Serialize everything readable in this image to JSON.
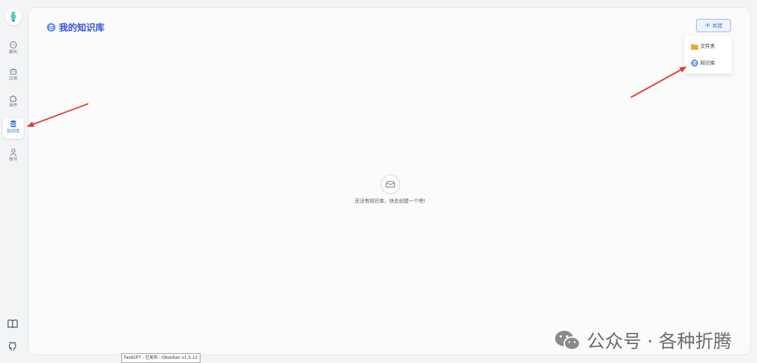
{
  "sidebar": {
    "items": [
      {
        "label": "聊天",
        "icon": "chat-icon"
      },
      {
        "label": "应用",
        "icon": "robot-icon"
      },
      {
        "label": "插件",
        "icon": "puzzle-icon"
      },
      {
        "label": "知识库",
        "icon": "database-icon",
        "active": true
      },
      {
        "label": "账号",
        "icon": "user-icon"
      }
    ],
    "bottom": [
      {
        "icon": "book-icon"
      },
      {
        "icon": "github-icon"
      }
    ]
  },
  "main": {
    "title": "我的知识库",
    "new_button": "新建",
    "menu": [
      {
        "label": "文件夹",
        "icon": "folder-icon"
      },
      {
        "label": "知识库",
        "icon": "database-icon"
      }
    ],
    "empty_text": "还没有知识库，快去创建一个吧!"
  },
  "tooltip": "FastGPT - 已发布 - Obsidian v1.5.12",
  "watermark": "公众号 · 各种折腾",
  "colors": {
    "accent": "#3370ff",
    "arrow": "#e53935",
    "folder": "#f5a623"
  }
}
